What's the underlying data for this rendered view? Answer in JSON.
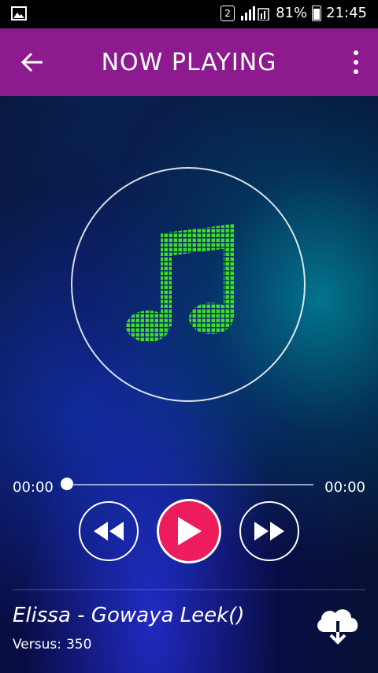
{
  "status_bar": {
    "sim_slot": "2",
    "battery": "81%",
    "time": "21:45"
  },
  "app_bar": {
    "title": "NOW PLAYING"
  },
  "player": {
    "current_time": "00:00",
    "total_time": "00:00",
    "progress": 0,
    "song_title": "Elissa - Gowaya Leek()",
    "versus_label": "Versus:",
    "versus_value": "350"
  },
  "colors": {
    "app_bar": "#8d1b8f",
    "play_button": "#ee1c5c",
    "note": "#3fdc28"
  },
  "icons": [
    "image-icon",
    "sim-icon",
    "signal-icon",
    "battery-icon",
    "back-arrow-icon",
    "more-vert-icon",
    "music-note-icon",
    "rewind-icon",
    "play-icon",
    "fast-forward-icon",
    "cloud-download-icon"
  ]
}
